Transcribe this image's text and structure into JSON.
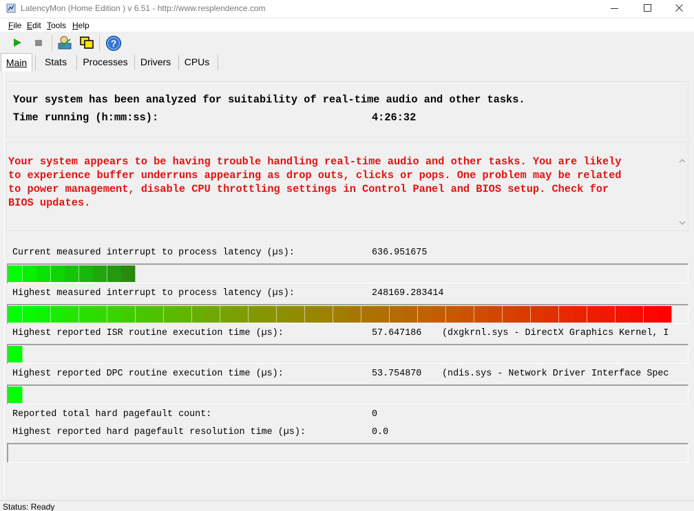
{
  "window": {
    "title": "LatencyMon  (Home Edition )  v 6.51 - http://www.resplendence.com"
  },
  "menu": {
    "items": [
      {
        "accel": "F",
        "rest": "ile"
      },
      {
        "accel": "E",
        "rest": "dit"
      },
      {
        "accel": "T",
        "rest": "ools"
      },
      {
        "accel": "H",
        "rest": "elp"
      }
    ]
  },
  "toolbar": {
    "icons": [
      "play-icon",
      "stop-icon",
      "user-icon",
      "windows-icon",
      "help-icon"
    ]
  },
  "tabs": [
    {
      "label": "Main",
      "active": true
    },
    {
      "label": "Stats",
      "active": false
    },
    {
      "label": "Processes",
      "active": false
    },
    {
      "label": "Drivers",
      "active": false
    },
    {
      "label": "CPUs",
      "active": false
    }
  ],
  "summary": {
    "headline": "Your system has been analyzed for suitability of real-time audio and other tasks.",
    "time_label": "Time running (h:mm:ss):",
    "time_value": "4:26:32"
  },
  "warning": {
    "lines": [
      "Your system appears to be having trouble handling real-time audio and other tasks. You are likely",
      "to experience buffer underruns appearing as drop outs, clicks or pops. One problem may be related",
      "to power management, disable CPU throttling settings in Control Panel and BIOS setup. Check for",
      "BIOS updates."
    ],
    "color": "#e31212"
  },
  "metrics": {
    "current_latency": {
      "label": "Current measured interrupt to process latency (µs):",
      "value": "636.951675",
      "bar_segments": 9
    },
    "highest_latency": {
      "label": "Highest measured interrupt to process latency (µs):",
      "value": "248169.283414",
      "bar_segments": 47
    },
    "isr": {
      "label": "Highest reported ISR routine execution time (µs):",
      "value": "57.647186",
      "extra": "(dxgkrnl.sys - DirectX Graphics Kernel, I",
      "bar_segments": 1
    },
    "dpc": {
      "label": "Highest reported DPC routine execution time (µs):",
      "value": "53.754870",
      "extra": "(ndis.sys - Network Driver Interface Spec",
      "bar_segments": 1
    },
    "pagefault_count": {
      "label": "Reported total hard pagefault count:",
      "value": "0"
    },
    "pagefault_time": {
      "label": "Highest reported hard pagefault resolution time (µs):",
      "value": "0.0",
      "bar_segments": 0
    }
  },
  "colors": {
    "bar_start": "#00ff00",
    "bar_end": "#ff0000",
    "current_bar_end": "#2a8a10"
  },
  "status": {
    "text": "Status: Ready"
  }
}
